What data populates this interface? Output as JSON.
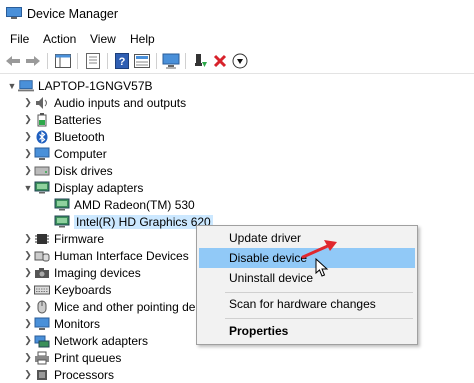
{
  "window": {
    "title": "Device Manager"
  },
  "menu": [
    "File",
    "Action",
    "View",
    "Help"
  ],
  "tree": {
    "root": "LAPTOP-1GNGV57B",
    "items": [
      {
        "label": "Audio inputs and outputs",
        "icon": "speaker-icon"
      },
      {
        "label": "Batteries",
        "icon": "battery-icon"
      },
      {
        "label": "Bluetooth",
        "icon": "bluetooth-icon"
      },
      {
        "label": "Computer",
        "icon": "computer-icon"
      },
      {
        "label": "Disk drives",
        "icon": "disk-drive-icon"
      },
      {
        "label": "Display adapters",
        "icon": "display-adapter-icon"
      },
      {
        "label": "AMD Radeon(TM) 530",
        "icon": "display-adapter-icon"
      },
      {
        "label": "Intel(R) HD Graphics 620",
        "icon": "display-adapter-icon"
      },
      {
        "label": "Firmware",
        "icon": "firmware-icon"
      },
      {
        "label": "Human Interface Devices",
        "icon": "hid-icon"
      },
      {
        "label": "Imaging devices",
        "icon": "camera-icon"
      },
      {
        "label": "Keyboards",
        "icon": "keyboard-icon"
      },
      {
        "label": "Mice and other pointing de",
        "icon": "mouse-icon"
      },
      {
        "label": "Monitors",
        "icon": "monitor-icon"
      },
      {
        "label": "Network adapters",
        "icon": "network-adapter-icon"
      },
      {
        "label": "Print queues",
        "icon": "printer-icon"
      },
      {
        "label": "Processors",
        "icon": "processor-icon"
      }
    ]
  },
  "context_menu": {
    "update": "Update driver",
    "disable": "Disable device",
    "uninstall": "Uninstall device",
    "scan": "Scan for hardware changes",
    "properties": "Properties"
  },
  "colors": {
    "selection": "#cce8ff",
    "menu_highlight": "#91c9f7",
    "arrow": "#e0282e"
  }
}
